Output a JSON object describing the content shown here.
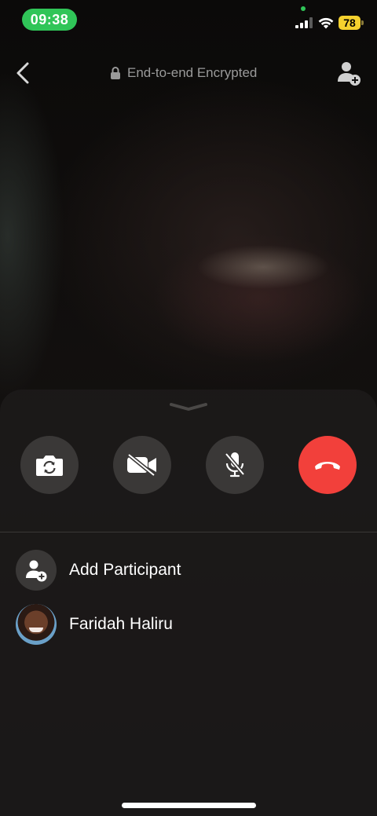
{
  "status_bar": {
    "time": "09:38",
    "battery_level": "78",
    "signal_icon": "cellular-signal-icon",
    "wifi_icon": "wifi-icon"
  },
  "header": {
    "encryption_label": "End-to-end Encrypted",
    "back_icon": "chevron-left-icon",
    "lock_icon": "lock-icon",
    "add_participant_icon": "person-add-icon"
  },
  "controls": [
    {
      "name": "flip-camera",
      "icon": "camera-flip-icon"
    },
    {
      "name": "video-off",
      "icon": "video-off-icon"
    },
    {
      "name": "mute",
      "icon": "mic-off-icon"
    },
    {
      "name": "end-call",
      "icon": "phone-hangup-icon",
      "color": "#f2403b"
    }
  ],
  "participants": {
    "add_label": "Add Participant",
    "members": [
      {
        "name": "Faridah Haliru"
      }
    ]
  },
  "colors": {
    "accent_green": "#30c558",
    "end_call_red": "#f2403b",
    "battery_yellow": "#f5d12e"
  }
}
